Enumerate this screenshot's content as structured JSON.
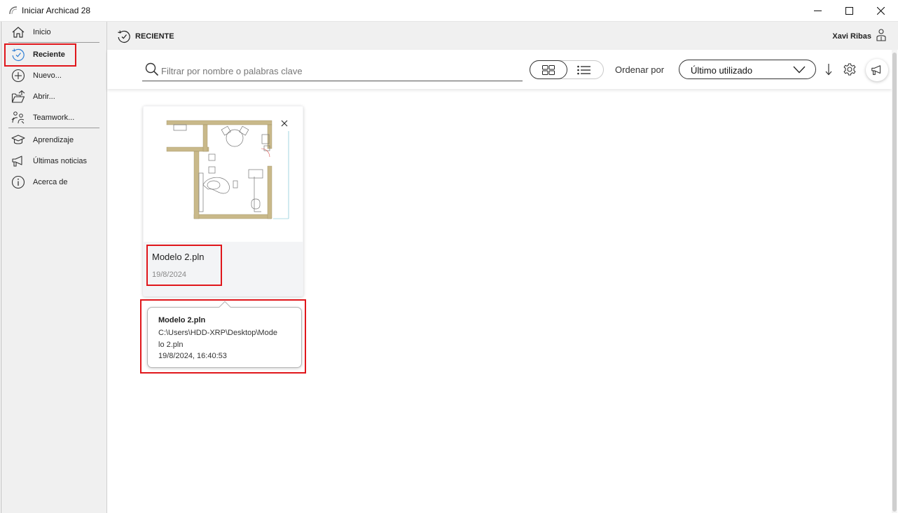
{
  "window": {
    "title": "Iniciar Archicad 28",
    "controls": [
      "minimize",
      "maximize",
      "close"
    ]
  },
  "sidebar": {
    "items": [
      {
        "label": "Inicio",
        "icon": "home-icon"
      },
      {
        "label": "Reciente",
        "icon": "recent-icon",
        "active": true
      },
      {
        "label": "Nuevo...",
        "icon": "plus-circle-icon"
      },
      {
        "label": "Abrir...",
        "icon": "open-folder-icon"
      },
      {
        "label": "Teamwork...",
        "icon": "teamwork-icon"
      },
      {
        "label": "Aprendizaje",
        "icon": "graduation-cap-icon"
      },
      {
        "label": "Últimas noticias",
        "icon": "megaphone-icon"
      },
      {
        "label": "Acerca de",
        "icon": "info-icon"
      }
    ]
  },
  "header": {
    "section_title": "RECIENTE",
    "user_name": "Xavi Ribas"
  },
  "toolbar": {
    "search_placeholder": "Filtrar por nombre o palabras clave",
    "view_mode": "grid",
    "sort_label": "Ordenar por",
    "sort_value": "Último utilizado",
    "sort_direction": "descending"
  },
  "files": [
    {
      "name": "Modelo 2.pln",
      "date": "19/8/2024",
      "tooltip": {
        "name": "Modelo 2.pln",
        "path": "C:\\Users\\HDD-XRP\\Desktop\\Modelo 2.pln",
        "modified": "19/8/2024, 16:40:53"
      }
    }
  ],
  "colors": {
    "highlight": "#e0161b",
    "sidebar_bg": "#f0f0f0",
    "wall": "#c9b98a",
    "recent_icon": "#2f7fd4"
  }
}
